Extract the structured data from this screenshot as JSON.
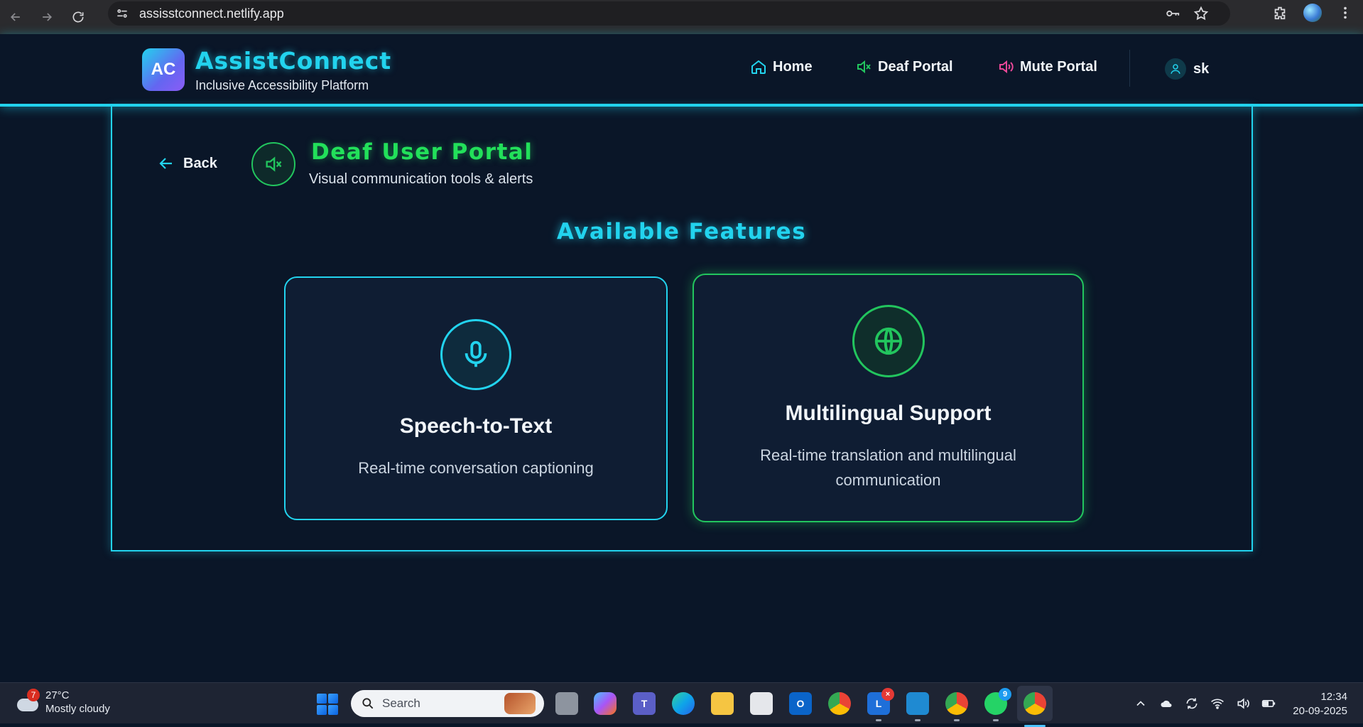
{
  "browser": {
    "url": "assisstconnect.netlify.app"
  },
  "header": {
    "logo_initials": "AC",
    "brand_title": "AssistConnect",
    "brand_subtitle": "Inclusive Accessibility Platform",
    "nav": {
      "home": "Home",
      "deaf_portal": "Deaf Portal",
      "mute_portal": "Mute Portal"
    },
    "user_name": "sk"
  },
  "portal": {
    "back_label": "Back",
    "title": "Deaf User Portal",
    "subtitle": "Visual communication tools & alerts",
    "section_title": "Available Features",
    "features": [
      {
        "title": "Speech-to-Text",
        "description": "Real-time conversation captioning",
        "icon": "microphone-icon"
      },
      {
        "title": "Multilingual Support",
        "description": "Real-time translation and multilingual communication",
        "icon": "globe-icon"
      }
    ]
  },
  "taskbar": {
    "weather": {
      "badge": "7",
      "temperature": "27°C",
      "condition": "Mostly cloudy"
    },
    "search_placeholder": "Search",
    "apps": [
      {
        "name": "task-view"
      },
      {
        "name": "copilot"
      },
      {
        "name": "teams"
      },
      {
        "name": "edge"
      },
      {
        "name": "file-explorer"
      },
      {
        "name": "microsoft-store"
      },
      {
        "name": "outlook"
      },
      {
        "name": "chrome"
      },
      {
        "name": "lens"
      },
      {
        "name": "vscode"
      },
      {
        "name": "chrome-profile"
      },
      {
        "name": "whatsapp",
        "badge": "9"
      },
      {
        "name": "chrome-active"
      }
    ],
    "clock": {
      "time": "12:34",
      "date": "20-09-2025"
    }
  },
  "colors": {
    "accent_cyan": "#22d3ee",
    "accent_green": "#22c55e",
    "accent_pink": "#ec4899",
    "background": "#0a1628"
  }
}
